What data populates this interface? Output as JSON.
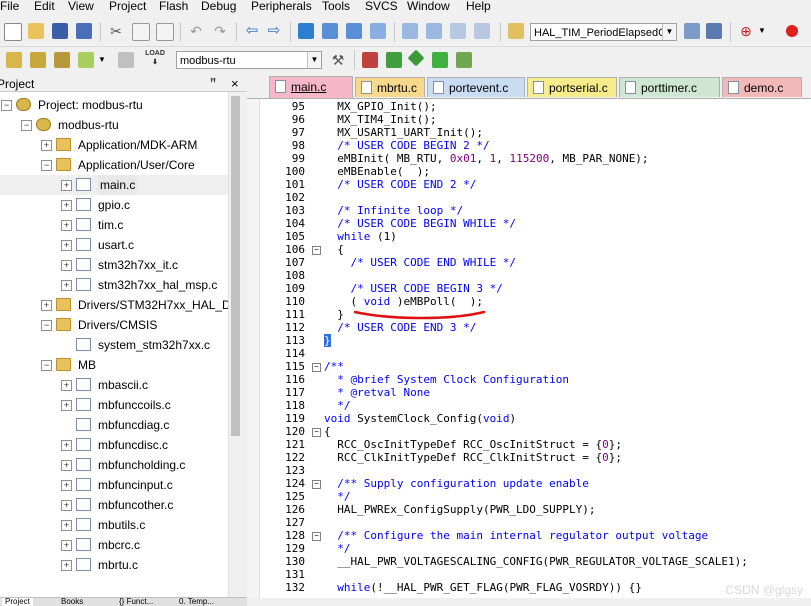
{
  "menu": [
    "File",
    "Edit",
    "View",
    "Project",
    "Flash",
    "Debug",
    "Peripherals",
    "Tools",
    "SVCS",
    "Window",
    "Help"
  ],
  "toolbar": {
    "function_combo": "HAL_TIM_PeriodElapsedC",
    "target_combo": "modbus-rtu",
    "load_label": "LOAD"
  },
  "project_panel": {
    "title": "Project",
    "pin": "ꟸ",
    "close": "×",
    "tree": [
      {
        "label": "Project: modbus-rtu",
        "depth": 0,
        "expander": "⊟",
        "icon": "gear"
      },
      {
        "label": "modbus-rtu",
        "depth": 1,
        "expander": "⊟",
        "icon": "gear"
      },
      {
        "label": "Application/MDK-ARM",
        "depth": 2,
        "expander": "+",
        "icon": "folder"
      },
      {
        "label": "Application/User/Core",
        "depth": 2,
        "expander": "−",
        "icon": "folder"
      },
      {
        "label": "main.c",
        "depth": 3,
        "expander": "+",
        "icon": "file",
        "selected": true
      },
      {
        "label": "gpio.c",
        "depth": 3,
        "expander": "+",
        "icon": "file"
      },
      {
        "label": "tim.c",
        "depth": 3,
        "expander": "+",
        "icon": "file"
      },
      {
        "label": "usart.c",
        "depth": 3,
        "expander": "+",
        "icon": "file"
      },
      {
        "label": "stm32h7xx_it.c",
        "depth": 3,
        "expander": "+",
        "icon": "file"
      },
      {
        "label": "stm32h7xx_hal_msp.c",
        "depth": 3,
        "expander": "+",
        "icon": "file"
      },
      {
        "label": "Drivers/STM32H7xx_HAL_D",
        "depth": 2,
        "expander": "+",
        "icon": "folder"
      },
      {
        "label": "Drivers/CMSIS",
        "depth": 2,
        "expander": "−",
        "icon": "folder"
      },
      {
        "label": "system_stm32h7xx.c",
        "depth": 3,
        "expander": "",
        "icon": "file"
      },
      {
        "label": "MB",
        "depth": 2,
        "expander": "−",
        "icon": "folder"
      },
      {
        "label": "mbascii.c",
        "depth": 3,
        "expander": "+",
        "icon": "file"
      },
      {
        "label": "mbfunccoils.c",
        "depth": 3,
        "expander": "+",
        "icon": "file"
      },
      {
        "label": "mbfuncdiag.c",
        "depth": 3,
        "expander": "",
        "icon": "file"
      },
      {
        "label": "mbfuncdisc.c",
        "depth": 3,
        "expander": "+",
        "icon": "file"
      },
      {
        "label": "mbfuncholding.c",
        "depth": 3,
        "expander": "+",
        "icon": "file"
      },
      {
        "label": "mbfuncinput.c",
        "depth": 3,
        "expander": "+",
        "icon": "file"
      },
      {
        "label": "mbfuncother.c",
        "depth": 3,
        "expander": "+",
        "icon": "file"
      },
      {
        "label": "mbutils.c",
        "depth": 3,
        "expander": "+",
        "icon": "file"
      },
      {
        "label": "mbcrc.c",
        "depth": 3,
        "expander": "+",
        "icon": "file"
      },
      {
        "label": "mbrtu.c",
        "depth": 3,
        "expander": "+",
        "icon": "file"
      }
    ],
    "bottom_tabs": [
      "Project",
      "Books",
      "{} Funct...",
      "0. Temp..."
    ]
  },
  "editor_tabs": [
    {
      "label": "main.c",
      "color": "#f6b8c8",
      "active": true
    },
    {
      "label": "mbrtu.c",
      "color": "#f7d98c"
    },
    {
      "label": "portevent.c",
      "color": "#c9dcf2"
    },
    {
      "label": "portserial.c",
      "color": "#f7ec8c"
    },
    {
      "label": "porttimer.c",
      "color": "#cfe6d2"
    },
    {
      "label": "demo.c",
      "color": "#f3b8b8"
    }
  ],
  "code_lines": [
    {
      "n": "95",
      "t": "  MX_GPIO_Init();"
    },
    {
      "n": "96",
      "t": "  MX_TIM4_Init();"
    },
    {
      "n": "97",
      "t": "  MX_USART1_UART_Init();"
    },
    {
      "n": "98",
      "t": "  /* USER CODE BEGIN 2 */",
      "c": "cmt"
    },
    {
      "n": "99",
      "t": "  eMBInit( MB_RTU, 0x01, 1, 115200, MB_PAR_NONE);"
    },
    {
      "n": "100",
      "t": "  eMBEnable(  );"
    },
    {
      "n": "101",
      "t": "  /* USER CODE END 2 */",
      "c": "cmt"
    },
    {
      "n": "102",
      "t": ""
    },
    {
      "n": "103",
      "t": "  /* Infinite loop */",
      "c": "cmt"
    },
    {
      "n": "104",
      "t": "  /* USER CODE BEGIN WHILE */",
      "c": "cmt"
    },
    {
      "n": "105",
      "t": "  while (1)",
      "c": "kwline"
    },
    {
      "n": "106",
      "t": "  {",
      "fold": "−"
    },
    {
      "n": "107",
      "t": "    /* USER CODE END WHILE */",
      "c": "cmt"
    },
    {
      "n": "108",
      "t": ""
    },
    {
      "n": "109",
      "t": "    /* USER CODE BEGIN 3 */",
      "c": "cmt"
    },
    {
      "n": "110",
      "t": "    ( void )eMBPoll(  );",
      "c": "voidline"
    },
    {
      "n": "111",
      "t": "  }"
    },
    {
      "n": "112",
      "t": "  /* USER CODE END 3 */",
      "c": "cmt"
    },
    {
      "n": "113",
      "t": "}",
      "c": "brace"
    },
    {
      "n": "114",
      "t": ""
    },
    {
      "n": "115",
      "t": "/**",
      "c": "cmt",
      "fold": "−"
    },
    {
      "n": "116",
      "t": "  * @brief System Clock Configuration",
      "c": "cmt"
    },
    {
      "n": "117",
      "t": "  * @retval None",
      "c": "cmt"
    },
    {
      "n": "118",
      "t": "  */",
      "c": "cmt"
    },
    {
      "n": "119",
      "t": "void SystemClock_Config(void)",
      "c": "voidfn"
    },
    {
      "n": "120",
      "t": "{",
      "fold": "−"
    },
    {
      "n": "121",
      "t": "  RCC_OscInitTypeDef RCC_OscInitStruct = {0};"
    },
    {
      "n": "122",
      "t": "  RCC_ClkInitTypeDef RCC_ClkInitStruct = {0};"
    },
    {
      "n": "123",
      "t": ""
    },
    {
      "n": "124",
      "t": "  /** Supply configuration update enable",
      "c": "cmt",
      "fold": "−"
    },
    {
      "n": "125",
      "t": "  */",
      "c": "cmt"
    },
    {
      "n": "126",
      "t": "  HAL_PWREx_ConfigSupply(PWR_LDO_SUPPLY);"
    },
    {
      "n": "127",
      "t": ""
    },
    {
      "n": "128",
      "t": "  /** Configure the main internal regulator output voltage",
      "c": "cmt",
      "fold": "−"
    },
    {
      "n": "129",
      "t": "  */",
      "c": "cmt"
    },
    {
      "n": "130",
      "t": "  __HAL_PWR_VOLTAGESCALING_CONFIG(PWR_REGULATOR_VOLTAGE_SCALE1);"
    },
    {
      "n": "131",
      "t": ""
    },
    {
      "n": "132",
      "t": "  while(!__HAL_PWR_GET_FLAG(PWR_FLAG_VOSRDY)) {}",
      "c": "kwline"
    }
  ],
  "watermark": "CSDN @glgsy"
}
